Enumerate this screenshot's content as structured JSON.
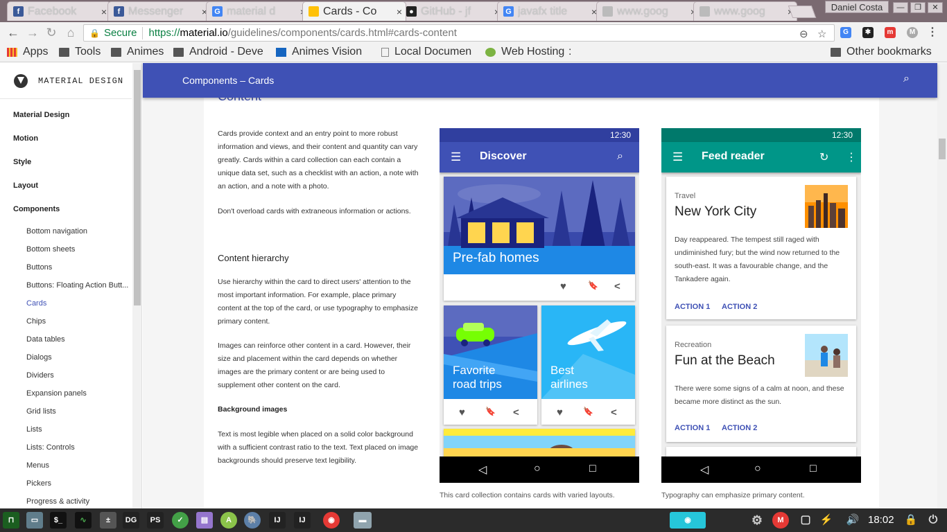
{
  "tabs": [
    {
      "title": "Facebook",
      "favicon": "facebook-icon",
      "color": "#3b5998",
      "glyph": "f"
    },
    {
      "title": "Messenger",
      "favicon": "facebook-icon",
      "color": "#3b5998",
      "glyph": "f"
    },
    {
      "title": "material d",
      "favicon": "google-icon",
      "color": "#4285f4",
      "glyph": "G"
    },
    {
      "title": "Cards - Co",
      "favicon": "material-icon",
      "color": "#ffc107",
      "glyph": ""
    },
    {
      "title": "GitHub - jf",
      "favicon": "github-icon",
      "color": "#222",
      "glyph": "●"
    },
    {
      "title": "javafx title",
      "favicon": "google-icon",
      "color": "#4285f4",
      "glyph": "G"
    },
    {
      "title": "www.goog",
      "favicon": "page-icon",
      "color": "#bbb",
      "glyph": ""
    },
    {
      "title": "www.goog",
      "favicon": "page-icon",
      "color": "#bbb",
      "glyph": ""
    }
  ],
  "tab_close": "×",
  "profile_name": "Daniel Costa",
  "window_buttons": {
    "minimize": "—",
    "restore": "❐",
    "close": "✕"
  },
  "toolbar": {
    "back": "←",
    "forward": "→",
    "reload": "↻",
    "home": "⌂"
  },
  "omnibox": {
    "secure_label": "Secure",
    "url_prefix": "https://",
    "url_host": "material.io",
    "url_path": "/guidelines/components/cards.html#cards-content",
    "lock": "🔒",
    "zoom": "⊖",
    "star": "☆"
  },
  "bookmarks": [
    {
      "label": "Apps",
      "icon": "apps-grid-icon"
    },
    {
      "label": "Tools",
      "icon": "folder-icon"
    },
    {
      "label": "Animes",
      "icon": "folder-icon"
    },
    {
      "label": "Android - Deve",
      "icon": "folder-icon"
    },
    {
      "label": "Animes Vision",
      "icon": "site-icon"
    },
    {
      "label": "Local Documen",
      "icon": "page-icon"
    },
    {
      "label": "Web Hosting",
      "icon": "hosting-icon"
    }
  ],
  "bookmarks_more": ":",
  "other_bookmarks": "Other bookmarks",
  "sidebar": {
    "brand": "MATERIAL DESIGN",
    "sections": [
      "Material Design",
      "Motion",
      "Style",
      "Layout",
      "Components"
    ],
    "components": [
      "Bottom navigation",
      "Bottom sheets",
      "Buttons",
      "Buttons: Floating Action Butt...",
      "Cards",
      "Chips",
      "Data tables",
      "Dialogs",
      "Dividers",
      "Expansion panels",
      "Grid lists",
      "Lists",
      "Lists: Controls",
      "Menus",
      "Pickers",
      "Progress & activity"
    ],
    "selected": "Cards"
  },
  "appbar": {
    "breadcrumb": "Components  –  Cards",
    "search": "⌕"
  },
  "article": {
    "heading_cut": "Content",
    "p1": "Cards provide context and an entry point to more robust information and views, and their content and quantity can vary greatly. Cards within a card collection can each contain a unique data set, such as a checklist with an action, a note with an action, and a note with a photo.",
    "p2": "Don't overload cards with extraneous information or actions.",
    "h_hierarchy": "Content hierarchy",
    "p3": "Use hierarchy within the card to direct users' attention to the most important information. For example, place primary content at the top of the card, or use typography to emphasize primary content.",
    "p4": "Images can reinforce other content in a card. However, their size and placement within the card depends on whether images are the primary content or are being used to supplement other content on the card.",
    "h_bg": "Background images",
    "p5": "Text is most legible when placed on a solid color background with a sufficient contrast ratio to the text. Text placed on image backgrounds should preserve text legibility.",
    "caption1": "This card collection contains cards with varied layouts.",
    "caption2": "Typography can emphasize primary content."
  },
  "phone1": {
    "time": "12:30",
    "title": "Discover",
    "bar_color": "#3f51b5",
    "status_color": "#303f9f",
    "card1_title": "Pre-fab homes",
    "card2_title_l1": "Favorite",
    "card2_title_l2": "road trips",
    "card3_title_l1": "Best",
    "card3_title_l2": "airlines"
  },
  "phone2": {
    "time": "12:30",
    "title": "Feed reader",
    "bar_color": "#009688",
    "status_color": "#00796b",
    "card1": {
      "category": "Travel",
      "title": "New York City",
      "body": "Day reappeared. The tempest still raged with undiminished fury; but the wind now returned to the south-east. It was a favourable change, and the Tankadere again.",
      "action1": "ACTION 1",
      "action2": "ACTION 2"
    },
    "card2": {
      "category": "Recreation",
      "title": "Fun at the Beach",
      "body": "There were some signs of a calm at noon, and these became more distinct as the sun.",
      "action1": "ACTION 1",
      "action2": "ACTION 2"
    }
  },
  "icons": {
    "menu": "☰",
    "search": "⌕",
    "refresh": "↻",
    "more": "⋮",
    "heart": "♥",
    "bookmark": "🔖",
    "share": "<",
    "back": "◁",
    "home": "○",
    "recent": "□"
  },
  "taskbar": {
    "clock": "18:02"
  }
}
